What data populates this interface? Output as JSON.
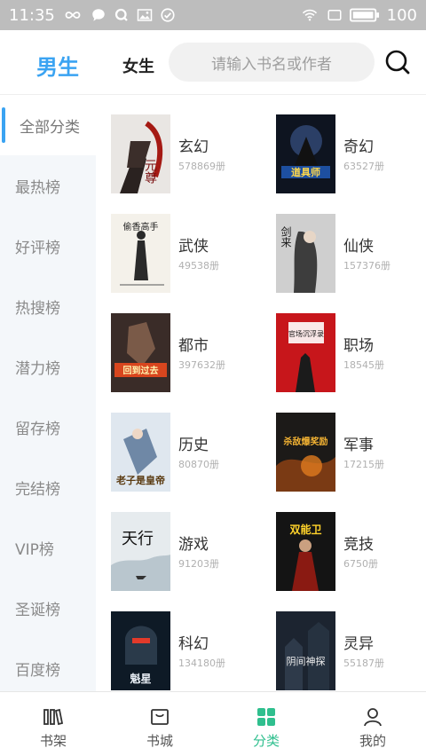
{
  "status_bar": {
    "time": "11:35",
    "battery": "100",
    "left_icons": [
      "infinity-icon",
      "message-bubble-icon",
      "q-app-icon",
      "gallery-icon",
      "check-circle-icon"
    ],
    "right_icons": [
      "wifi-icon",
      "screen-rotate-icon",
      "battery-icon"
    ]
  },
  "header": {
    "tab_male": "男生",
    "tab_female": "女生",
    "search_placeholder": "请输入书名或作者",
    "accent_color": "#3aa3f2"
  },
  "sidebar": {
    "items": [
      {
        "label": "全部分类",
        "active": true
      },
      {
        "label": "最热榜"
      },
      {
        "label": "好评榜"
      },
      {
        "label": "热搜榜"
      },
      {
        "label": "潜力榜"
      },
      {
        "label": "留存榜"
      },
      {
        "label": "完结榜"
      },
      {
        "label": "VIP榜"
      },
      {
        "label": "圣诞榜"
      },
      {
        "label": "百度榜"
      }
    ]
  },
  "categories": [
    {
      "name": "玄幻",
      "count": "578869册",
      "cover_title": "元尊"
    },
    {
      "name": "奇幻",
      "count": "63527册",
      "cover_title": "道具师"
    },
    {
      "name": "武侠",
      "count": "49538册",
      "cover_title": "偷香高手"
    },
    {
      "name": "仙侠",
      "count": "157376册",
      "cover_title": "剑来"
    },
    {
      "name": "都市",
      "count": "397632册",
      "cover_title": "回到过去"
    },
    {
      "name": "职场",
      "count": "18545册",
      "cover_title": "官场沉浮录"
    },
    {
      "name": "历史",
      "count": "80870册",
      "cover_title": "老子是皇帝"
    },
    {
      "name": "军事",
      "count": "17215册",
      "cover_title": "杀敌爆奖励"
    },
    {
      "name": "游戏",
      "count": "91203册",
      "cover_title": "天行"
    },
    {
      "name": "竞技",
      "count": "6750册",
      "cover_title": "双能卫"
    },
    {
      "name": "科幻",
      "count": "134180册",
      "cover_title": "魁星"
    },
    {
      "name": "灵异",
      "count": "55187册",
      "cover_title": "阴间神探"
    }
  ],
  "bottom_nav": {
    "items": [
      {
        "label": "书架",
        "icon": "bookshelf-icon"
      },
      {
        "label": "书城",
        "icon": "store-icon"
      },
      {
        "label": "分类",
        "icon": "category-grid-icon",
        "active": true
      },
      {
        "label": "我的",
        "icon": "profile-icon"
      }
    ],
    "active_color": "#2fbf8e"
  }
}
